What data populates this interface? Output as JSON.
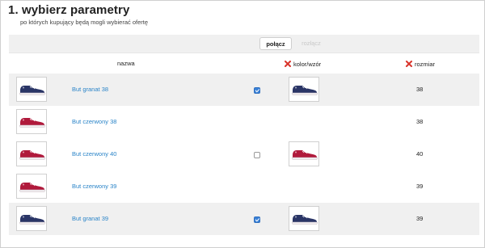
{
  "title": "1. wybierz parametry",
  "subtitle": "po których kupujący będą mogli wybierać ofertę",
  "toolbar": {
    "join_label": "połącz",
    "split_label": "rozłącz"
  },
  "columns": {
    "name": "nazwa",
    "color": "kolor/wzór",
    "size": "rozmiar"
  },
  "colors": {
    "navy": "#2a3566",
    "red": "#b0193b",
    "link": "#2a84c8",
    "remove": "#d9342b"
  },
  "rows": [
    {
      "name": "But granat 38",
      "size": "38",
      "color": "navy",
      "checkbox": "checked",
      "swatch": "navy",
      "shaded": true
    },
    {
      "name": "But czerwony 38",
      "size": "38",
      "color": "red",
      "checkbox": "none",
      "swatch": "none",
      "shaded": false
    },
    {
      "name": "But czerwony 40",
      "size": "40",
      "color": "red",
      "checkbox": "unchecked",
      "swatch": "red",
      "shaded": false
    },
    {
      "name": "But czerwony 39",
      "size": "39",
      "color": "red",
      "checkbox": "none",
      "swatch": "none",
      "shaded": false
    },
    {
      "name": "But granat 39",
      "size": "39",
      "color": "navy",
      "checkbox": "checked",
      "swatch": "navy",
      "shaded": true
    }
  ]
}
